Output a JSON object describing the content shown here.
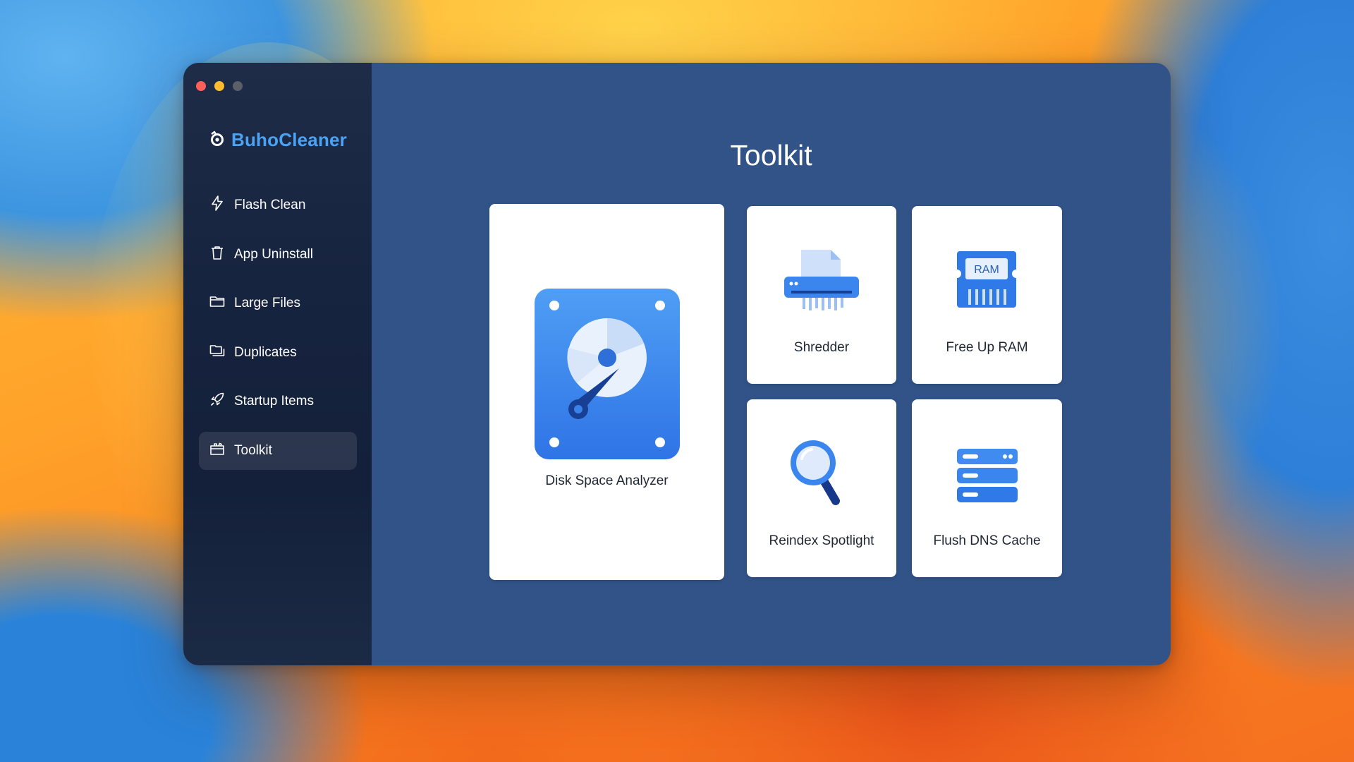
{
  "app": {
    "name": "BuhoCleaner",
    "brand_color": "#4aa3f4",
    "logo_icon": "buho-logo-icon"
  },
  "window_controls": [
    "close",
    "minimize",
    "zoom"
  ],
  "sidebar": {
    "items": [
      {
        "label": "Flash Clean",
        "icon": "bolt-icon",
        "active": false
      },
      {
        "label": "App Uninstall",
        "icon": "trash-icon",
        "active": false
      },
      {
        "label": "Large Files",
        "icon": "folder-icon",
        "active": false
      },
      {
        "label": "Duplicates",
        "icon": "duplicates-icon",
        "active": false
      },
      {
        "label": "Startup Items",
        "icon": "rocket-icon",
        "active": false
      },
      {
        "label": "Toolkit",
        "icon": "toolbox-icon",
        "active": true
      }
    ]
  },
  "main": {
    "title": "Toolkit",
    "background": "#315388",
    "tools": [
      {
        "label": "Disk Space Analyzer",
        "icon": "hard-disk-icon"
      },
      {
        "label": "Shredder",
        "icon": "shredder-icon"
      },
      {
        "label": "Free Up RAM",
        "icon": "ram-chip-icon",
        "icon_text": "RAM"
      },
      {
        "label": "Reindex Spotlight",
        "icon": "magnifier-icon"
      },
      {
        "label": "Flush DNS Cache",
        "icon": "server-icon"
      }
    ]
  }
}
